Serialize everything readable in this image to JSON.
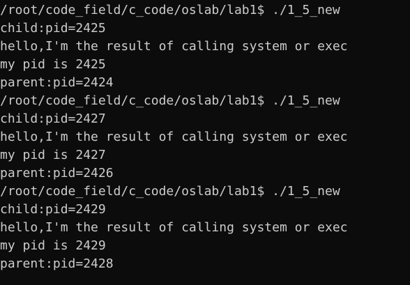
{
  "terminal": {
    "background": "#0c0c0c",
    "foreground": "#cccccc",
    "lines": [
      "/root/code_field/c_code/oslab/lab1$ ./1_5_new",
      "child:pid=2425",
      "hello,I'm the result of calling system or exec",
      "my pid is 2425",
      "parent:pid=2424",
      "/root/code_field/c_code/oslab/lab1$ ./1_5_new",
      "child:pid=2427",
      "hello,I'm the result of calling system or exec",
      "my pid is 2427",
      "parent:pid=2426",
      "/root/code_field/c_code/oslab/lab1$ ./1_5_new",
      "child:pid=2429",
      "hello,I'm the result of calling system or exec",
      "my pid is 2429",
      "parent:pid=2428"
    ]
  }
}
